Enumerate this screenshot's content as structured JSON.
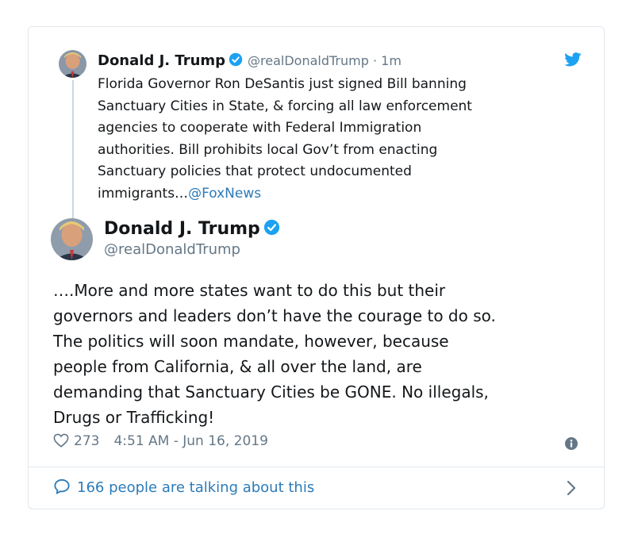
{
  "colors": {
    "link": "#2b7bb9",
    "verified": "#1da1f2",
    "muted": "#657786",
    "border": "#e1e8ed"
  },
  "reply": {
    "name": "Donald J. Trump",
    "handle": "@realDonaldTrump",
    "time": "· 1m",
    "text_lines": [
      "Florida Governor Ron DeSantis just signed Bill banning",
      "Sanctuary Cities in State, & forcing all law enforcement",
      "agencies to cooperate with Federal Immigration",
      "authorities. Bill prohibits local Gov’t from enacting",
      "Sanctuary policies that protect undocumented"
    ],
    "last_line_text": "immigrants…",
    "mention": "@FoxNews"
  },
  "tweet": {
    "name": "Donald J. Trump",
    "handle": "@realDonaldTrump",
    "text_lines": [
      "….More and more states want to do this but their",
      "governors and leaders don’t have the courage to do so.",
      "The politics will soon mandate, however, because",
      "people from California, & all over the land, are",
      "demanding that Sanctuary Cities be GONE. No illegals,",
      "Drugs or Trafficking!"
    ],
    "likes": "273",
    "timestamp": "4:51 AM - Jun 16, 2019"
  },
  "footer": {
    "talking": "166 people are talking about this"
  },
  "icons": [
    "verified-badge-icon",
    "twitter-bird-icon",
    "heart-icon",
    "info-icon",
    "comment-bubble-icon",
    "chevron-right-icon"
  ]
}
